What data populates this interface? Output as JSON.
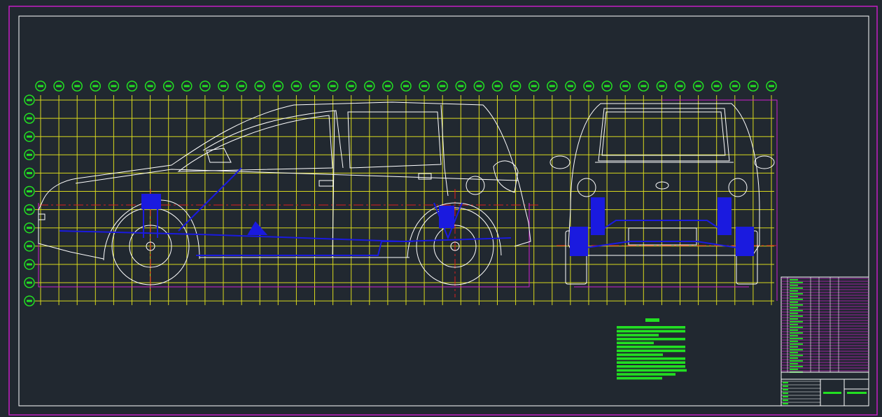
{
  "drawing": {
    "background": "#212830",
    "colors": {
      "outer_border": "#c41ec4",
      "frame": "#ffffff",
      "grid": "#d8d81e",
      "bubble": "#22e022",
      "body_outline": "#ffffff",
      "chassis": "#1a1adf",
      "centerline": "#e01e1e",
      "ground": "#d020d0",
      "notes": "#22e022",
      "title_block_rows": "#c41ec4"
    },
    "grid": {
      "column_count": 41,
      "row_count": 12
    },
    "icons": {
      "column_marker": "circle-bubble-icon",
      "row_marker": "circle-bubble-icon",
      "front_wheel": "wheel-icon",
      "rear_wheel": "wheel-icon",
      "shock_absorber": "coil-spring-icon"
    }
  }
}
